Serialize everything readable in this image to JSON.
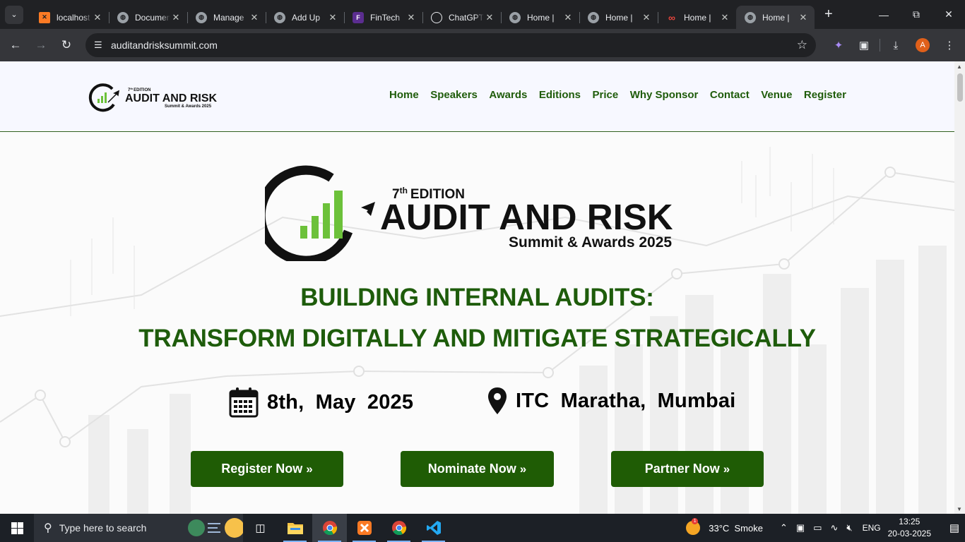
{
  "browser": {
    "tabs": [
      {
        "title": "localhost",
        "favicon": "xampp-icon",
        "active": false
      },
      {
        "title": "Documents",
        "favicon": "globe-icon",
        "active": false
      },
      {
        "title": "Manage",
        "favicon": "globe-icon",
        "active": false
      },
      {
        "title": "Add Up",
        "favicon": "globe-icon",
        "active": false
      },
      {
        "title": "FinTech",
        "favicon": "fintech-icon",
        "active": false
      },
      {
        "title": "ChatGPT",
        "favicon": "chatgpt-icon",
        "active": false
      },
      {
        "title": "Home |",
        "favicon": "globe-icon",
        "active": false
      },
      {
        "title": "Home |",
        "favicon": "globe-icon",
        "active": false
      },
      {
        "title": "Home |",
        "favicon": "meta-icon",
        "active": false
      },
      {
        "title": "Home |",
        "favicon": "globe-icon",
        "active": true
      }
    ],
    "url": "auditandrisksummit.com",
    "profile_initial": "A"
  },
  "site": {
    "logo": {
      "edition_num": "7",
      "edition_sup": "th",
      "edition_word": "EDITION",
      "name": "AUDIT AND RISK",
      "sub": "Summit & Awards 2025"
    },
    "nav": [
      "Home",
      "Speakers",
      "Awards",
      "Editions",
      "Price",
      "Why Sponsor",
      "Contact",
      "Venue",
      "Register"
    ],
    "hero": {
      "headline_1": "BUILDING INTERNAL AUDITS:",
      "headline_2": "TRANSFORM DIGITALLY AND MITIGATE STRATEGICALLY",
      "date": "8th, May 2025",
      "venue": "ITC Maratha, Mumbai",
      "buttons": [
        "Register Now",
        "Nominate Now",
        "Partner Now"
      ]
    },
    "colors": {
      "brand_green": "#1f5c05",
      "logo_green": "#6cc13a",
      "header_bg": "#f7f8ff"
    }
  },
  "taskbar": {
    "search_placeholder": "Type here to search",
    "weather_temp": "33°C",
    "weather_desc": "Smoke",
    "weather_badge": "1",
    "lang": "ENG",
    "time": "13:25",
    "date": "20-03-2025",
    "apps": [
      "task-view-icon",
      "file-explorer-icon",
      "chrome-icon",
      "xampp-icon",
      "chrome-icon",
      "vscode-icon"
    ]
  }
}
